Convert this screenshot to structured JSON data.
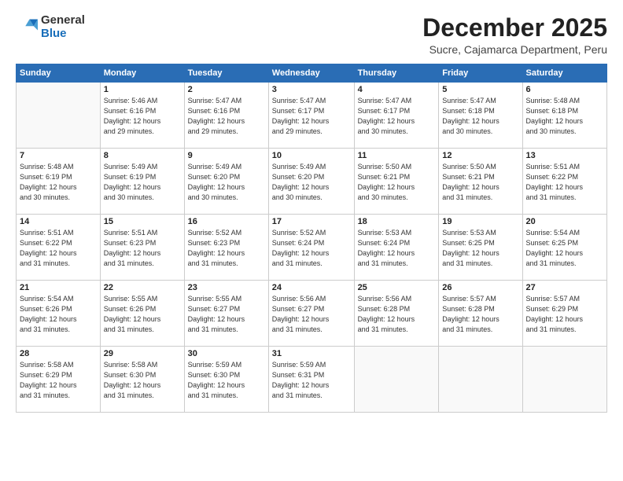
{
  "logo": {
    "general": "General",
    "blue": "Blue"
  },
  "title": "December 2025",
  "subtitle": "Sucre, Cajamarca Department, Peru",
  "headers": [
    "Sunday",
    "Monday",
    "Tuesday",
    "Wednesday",
    "Thursday",
    "Friday",
    "Saturday"
  ],
  "weeks": [
    [
      {
        "day": "",
        "info": ""
      },
      {
        "day": "1",
        "info": "Sunrise: 5:46 AM\nSunset: 6:16 PM\nDaylight: 12 hours\nand 29 minutes."
      },
      {
        "day": "2",
        "info": "Sunrise: 5:47 AM\nSunset: 6:16 PM\nDaylight: 12 hours\nand 29 minutes."
      },
      {
        "day": "3",
        "info": "Sunrise: 5:47 AM\nSunset: 6:17 PM\nDaylight: 12 hours\nand 29 minutes."
      },
      {
        "day": "4",
        "info": "Sunrise: 5:47 AM\nSunset: 6:17 PM\nDaylight: 12 hours\nand 30 minutes."
      },
      {
        "day": "5",
        "info": "Sunrise: 5:47 AM\nSunset: 6:18 PM\nDaylight: 12 hours\nand 30 minutes."
      },
      {
        "day": "6",
        "info": "Sunrise: 5:48 AM\nSunset: 6:18 PM\nDaylight: 12 hours\nand 30 minutes."
      }
    ],
    [
      {
        "day": "7",
        "info": "Sunrise: 5:48 AM\nSunset: 6:19 PM\nDaylight: 12 hours\nand 30 minutes."
      },
      {
        "day": "8",
        "info": "Sunrise: 5:49 AM\nSunset: 6:19 PM\nDaylight: 12 hours\nand 30 minutes."
      },
      {
        "day": "9",
        "info": "Sunrise: 5:49 AM\nSunset: 6:20 PM\nDaylight: 12 hours\nand 30 minutes."
      },
      {
        "day": "10",
        "info": "Sunrise: 5:49 AM\nSunset: 6:20 PM\nDaylight: 12 hours\nand 30 minutes."
      },
      {
        "day": "11",
        "info": "Sunrise: 5:50 AM\nSunset: 6:21 PM\nDaylight: 12 hours\nand 30 minutes."
      },
      {
        "day": "12",
        "info": "Sunrise: 5:50 AM\nSunset: 6:21 PM\nDaylight: 12 hours\nand 31 minutes."
      },
      {
        "day": "13",
        "info": "Sunrise: 5:51 AM\nSunset: 6:22 PM\nDaylight: 12 hours\nand 31 minutes."
      }
    ],
    [
      {
        "day": "14",
        "info": "Sunrise: 5:51 AM\nSunset: 6:22 PM\nDaylight: 12 hours\nand 31 minutes."
      },
      {
        "day": "15",
        "info": "Sunrise: 5:51 AM\nSunset: 6:23 PM\nDaylight: 12 hours\nand 31 minutes."
      },
      {
        "day": "16",
        "info": "Sunrise: 5:52 AM\nSunset: 6:23 PM\nDaylight: 12 hours\nand 31 minutes."
      },
      {
        "day": "17",
        "info": "Sunrise: 5:52 AM\nSunset: 6:24 PM\nDaylight: 12 hours\nand 31 minutes."
      },
      {
        "day": "18",
        "info": "Sunrise: 5:53 AM\nSunset: 6:24 PM\nDaylight: 12 hours\nand 31 minutes."
      },
      {
        "day": "19",
        "info": "Sunrise: 5:53 AM\nSunset: 6:25 PM\nDaylight: 12 hours\nand 31 minutes."
      },
      {
        "day": "20",
        "info": "Sunrise: 5:54 AM\nSunset: 6:25 PM\nDaylight: 12 hours\nand 31 minutes."
      }
    ],
    [
      {
        "day": "21",
        "info": "Sunrise: 5:54 AM\nSunset: 6:26 PM\nDaylight: 12 hours\nand 31 minutes."
      },
      {
        "day": "22",
        "info": "Sunrise: 5:55 AM\nSunset: 6:26 PM\nDaylight: 12 hours\nand 31 minutes."
      },
      {
        "day": "23",
        "info": "Sunrise: 5:55 AM\nSunset: 6:27 PM\nDaylight: 12 hours\nand 31 minutes."
      },
      {
        "day": "24",
        "info": "Sunrise: 5:56 AM\nSunset: 6:27 PM\nDaylight: 12 hours\nand 31 minutes."
      },
      {
        "day": "25",
        "info": "Sunrise: 5:56 AM\nSunset: 6:28 PM\nDaylight: 12 hours\nand 31 minutes."
      },
      {
        "day": "26",
        "info": "Sunrise: 5:57 AM\nSunset: 6:28 PM\nDaylight: 12 hours\nand 31 minutes."
      },
      {
        "day": "27",
        "info": "Sunrise: 5:57 AM\nSunset: 6:29 PM\nDaylight: 12 hours\nand 31 minutes."
      }
    ],
    [
      {
        "day": "28",
        "info": "Sunrise: 5:58 AM\nSunset: 6:29 PM\nDaylight: 12 hours\nand 31 minutes."
      },
      {
        "day": "29",
        "info": "Sunrise: 5:58 AM\nSunset: 6:30 PM\nDaylight: 12 hours\nand 31 minutes."
      },
      {
        "day": "30",
        "info": "Sunrise: 5:59 AM\nSunset: 6:30 PM\nDaylight: 12 hours\nand 31 minutes."
      },
      {
        "day": "31",
        "info": "Sunrise: 5:59 AM\nSunset: 6:31 PM\nDaylight: 12 hours\nand 31 minutes."
      },
      {
        "day": "",
        "info": ""
      },
      {
        "day": "",
        "info": ""
      },
      {
        "day": "",
        "info": ""
      }
    ]
  ]
}
